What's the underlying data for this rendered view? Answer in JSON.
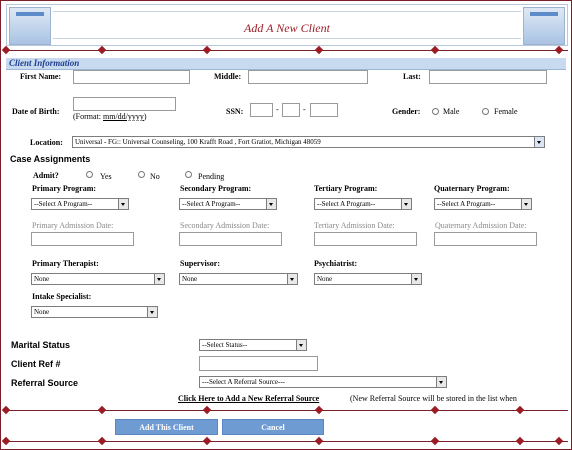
{
  "page_title": "Add A New Client",
  "section_title": "Client Information",
  "names": {
    "first_label": "First Name:",
    "middle_label": "Middle:",
    "last_label": "Last:"
  },
  "dob": {
    "label": "Date of Birth:",
    "format_prefix": "(Format: ",
    "format_value": "mm/dd/yyyy",
    "format_suffix": ")"
  },
  "ssn": {
    "label": "SSN:",
    "dash": "-"
  },
  "gender": {
    "label": "Gender:",
    "male": "Male",
    "female": "Female"
  },
  "location": {
    "label": "Location:",
    "value": "Universal - FG:: Universal Counseling, 100 Krafft Road , Fort Gratiot, Michigan 48059"
  },
  "case_assignments": {
    "title": "Case Assignments",
    "admit_label": "Admit?",
    "admit_yes": "Yes",
    "admit_no": "No",
    "admit_pending": "Pending"
  },
  "programs": [
    {
      "label": "Primary Program:",
      "select": "--Select A Program--",
      "date_label": "Primary Admission Date:"
    },
    {
      "label": "Secondary Program:",
      "select": "--Select A Program--",
      "date_label": "Secondary Admission Date:"
    },
    {
      "label": "Tertiary Program:",
      "select": "--Select A Program--",
      "date_label": "Tertiary Admission Date:"
    },
    {
      "label": "Quaternary Program:",
      "select": "--Select A Program--",
      "date_label": "Quaternary Admission Date:"
    }
  ],
  "staff": [
    {
      "label": "Primary Therapist:",
      "value": "None"
    },
    {
      "label": "Supervisor:",
      "value": "None"
    },
    {
      "label": "Psychiatrist:",
      "value": "None"
    },
    {
      "label": "Intake Specialist:",
      "value": "None"
    }
  ],
  "marital": {
    "label": "Marital Status",
    "value": "--Select Status--"
  },
  "client_ref": {
    "label": "Client Ref #"
  },
  "referral": {
    "label": "Referral Source",
    "value": "---Select A Referral Source---",
    "add_link": "Click Here to Add a New Referral Source",
    "note": " (New Referral Source will be stored in the list when"
  },
  "buttons": {
    "add": "Add This Client",
    "cancel": "Cancel"
  },
  "colors": {
    "accent": "#9b1c24",
    "section_bg": "#c7daf0",
    "button_bg": "#6f9bd3"
  }
}
